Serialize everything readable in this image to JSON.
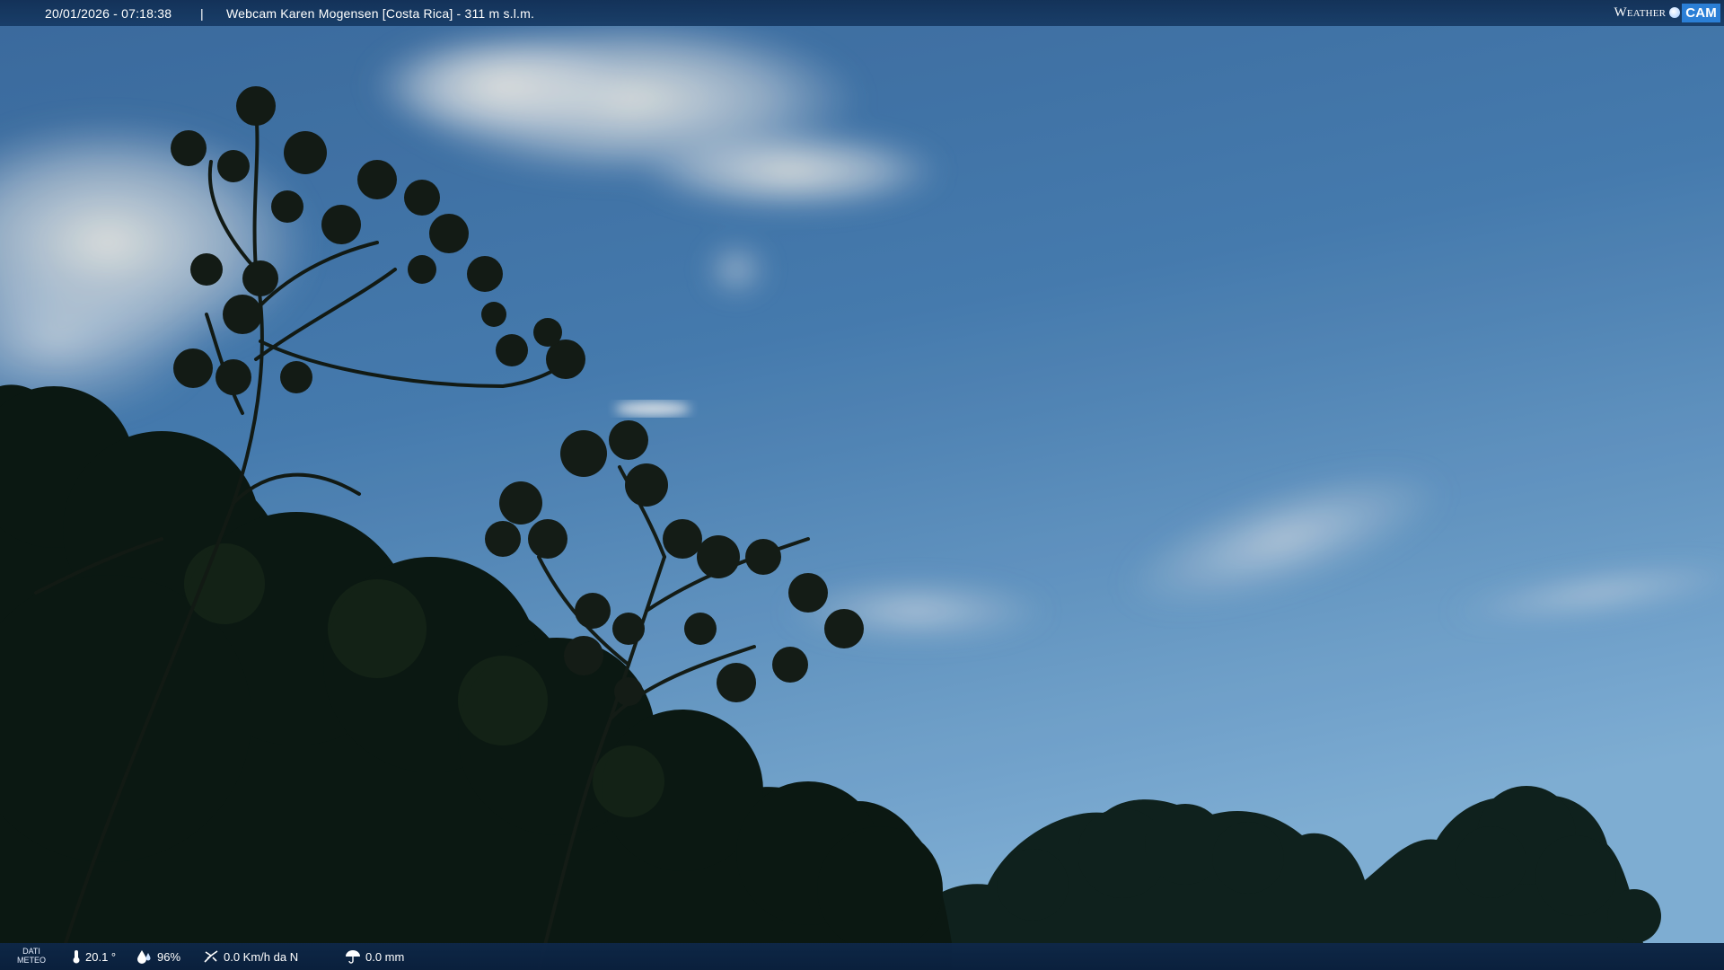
{
  "header": {
    "datetime": "20/01/2026 - 07:18:38",
    "separator": "|",
    "title": "Webcam Karen Mogensen [Costa Rica] - 311 m s.l.m."
  },
  "brand": {
    "word_weather": "Weather",
    "word_cam": "CAM"
  },
  "weather": {
    "label_line1": "DATI",
    "label_line2": "METEO",
    "temperature": "20.1 °",
    "humidity": "96%",
    "wind": "0.0 Km/h da N",
    "rain": "0.0 mm"
  },
  "icons": {
    "temperature": "thermometer-icon",
    "humidity": "humidity-drop-icon",
    "wind": "wind-vane-icon",
    "rain": "rain-umbrella-icon"
  },
  "colors": {
    "bar": "#163a64",
    "sky_top": "#3b6ea5",
    "sky_bottom": "#79aedc",
    "brand_cam": "#2b7fd6"
  }
}
